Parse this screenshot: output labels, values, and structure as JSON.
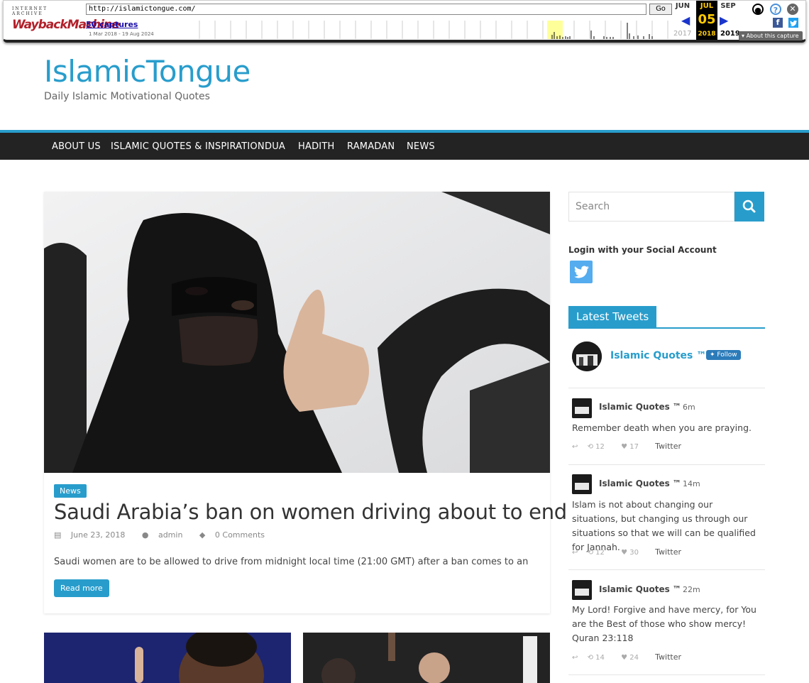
{
  "wayback": {
    "logo_top": "INTERNET ARCHIVE",
    "logo_main": "WaybackMachine",
    "url": "http://islamictongue.com/",
    "go_label": "Go",
    "captures": "50 captures",
    "range": "1 Mar 2018 - 19 Aug 2024",
    "month_prev": "JUN",
    "month_cur": "JUL",
    "month_next": "SEP",
    "day": "05",
    "year_prev": "2017",
    "year_cur": "2018",
    "year_next": "2019",
    "about": "About this capture"
  },
  "site": {
    "title": "IslamicTongue",
    "tagline": "Daily Islamic Motivational Quotes",
    "accent": "#289dcc"
  },
  "nav": [
    {
      "label": "ABOUT US"
    },
    {
      "label": "ISLAMIC QUOTES & INSPIRATION"
    },
    {
      "label": "DUA"
    },
    {
      "label": "HADITH"
    },
    {
      "label": "RAMADAN"
    },
    {
      "label": "NEWS"
    }
  ],
  "post": {
    "category": "News",
    "title": "Saudi Arabia’s ban on women driving about to end",
    "date": "June 23, 2018",
    "author": "admin",
    "comments": "0 Comments",
    "excerpt": "Saudi women are to be allowed to drive from midnight local time (21:00 GMT) after a ban comes to an",
    "read_more": "Read more"
  },
  "sidebar": {
    "search_placeholder": "Search",
    "login_heading": "Login with your Social Account",
    "tweets_heading": "Latest Tweets",
    "profile_name": " Islamic Quotes ™",
    "follow_label": "Follow",
    "tweets": [
      {
        "name": " Islamic Quotes ™",
        "time": "6m",
        "text": "Remember death when you are praying.",
        "retweets": "12",
        "likes": "17",
        "link": "Twitter"
      },
      {
        "name": " Islamic Quotes ™",
        "time": "14m",
        "text": "Islam is not about changing our situations, but changing us through our situations so that we will can be qualified for Jannah.",
        "retweets": "12",
        "likes": "30",
        "link": "Twitter"
      },
      {
        "name": " Islamic Quotes ™",
        "time": "22m",
        "text": "My Lord! Forgive and have mercy, for You are the Best of those who show mercy! Quran 23:118",
        "retweets": "14",
        "likes": "24",
        "link": "Twitter"
      }
    ]
  }
}
